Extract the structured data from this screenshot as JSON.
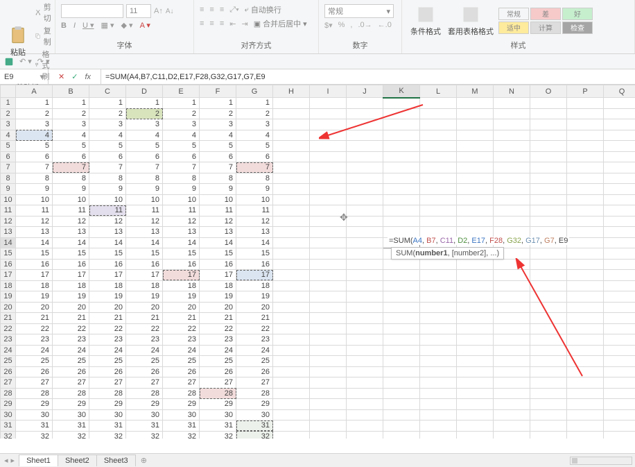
{
  "ribbon": {
    "clipboard": {
      "paste": "粘贴",
      "cut": "剪切",
      "copy": "复制",
      "brush": "格式刷",
      "label": "剪贴板"
    },
    "font": {
      "size": "11",
      "label": "字体"
    },
    "align": {
      "wrap": "自动换行",
      "merge": "合并后居中",
      "label": "对齐方式"
    },
    "number": {
      "general": "常规",
      "label": "数字"
    },
    "styles": {
      "cond": "条件格式",
      "tbl": "套用表格格式",
      "normal": "常规",
      "bad": "差",
      "good": "好",
      "neutral": "适中",
      "calc": "计算",
      "check": "检查",
      "label": "样式"
    }
  },
  "namebox": "E9",
  "formula_plain": "=SUM(A4,B7,C11,D2,E17,F28,G32,G17,G7,E9",
  "inline_formula": {
    "pre": "=SUM(",
    "a": "A4",
    "b": "B7",
    "c": "C11",
    "d": "D2",
    "e": "E17",
    "f": "F28",
    "g": "G32",
    "h": "G17",
    "i": "G7",
    "j": "E9"
  },
  "tooltip": {
    "fn": "SUM(",
    "b": "number1",
    "rest": ", [number2], ...)"
  },
  "cols": [
    "A",
    "B",
    "C",
    "D",
    "E",
    "F",
    "G",
    "H",
    "I",
    "J",
    "K",
    "L",
    "M",
    "N",
    "O",
    "P",
    "Q"
  ],
  "rows": 33,
  "grid_data_cols": [
    "A",
    "B",
    "C",
    "D",
    "E",
    "F",
    "G"
  ],
  "cell_highlights": {
    "A4": "b",
    "B7": "r",
    "C11": "p",
    "D2": "g",
    "E17": "r",
    "F28": "r",
    "G7": "r",
    "G17": "b",
    "G31": "t",
    "G32": "t"
  },
  "tabs": {
    "s1": "Sheet1",
    "s2": "Sheet2",
    "s3": "Sheet3"
  },
  "chart_data": null
}
